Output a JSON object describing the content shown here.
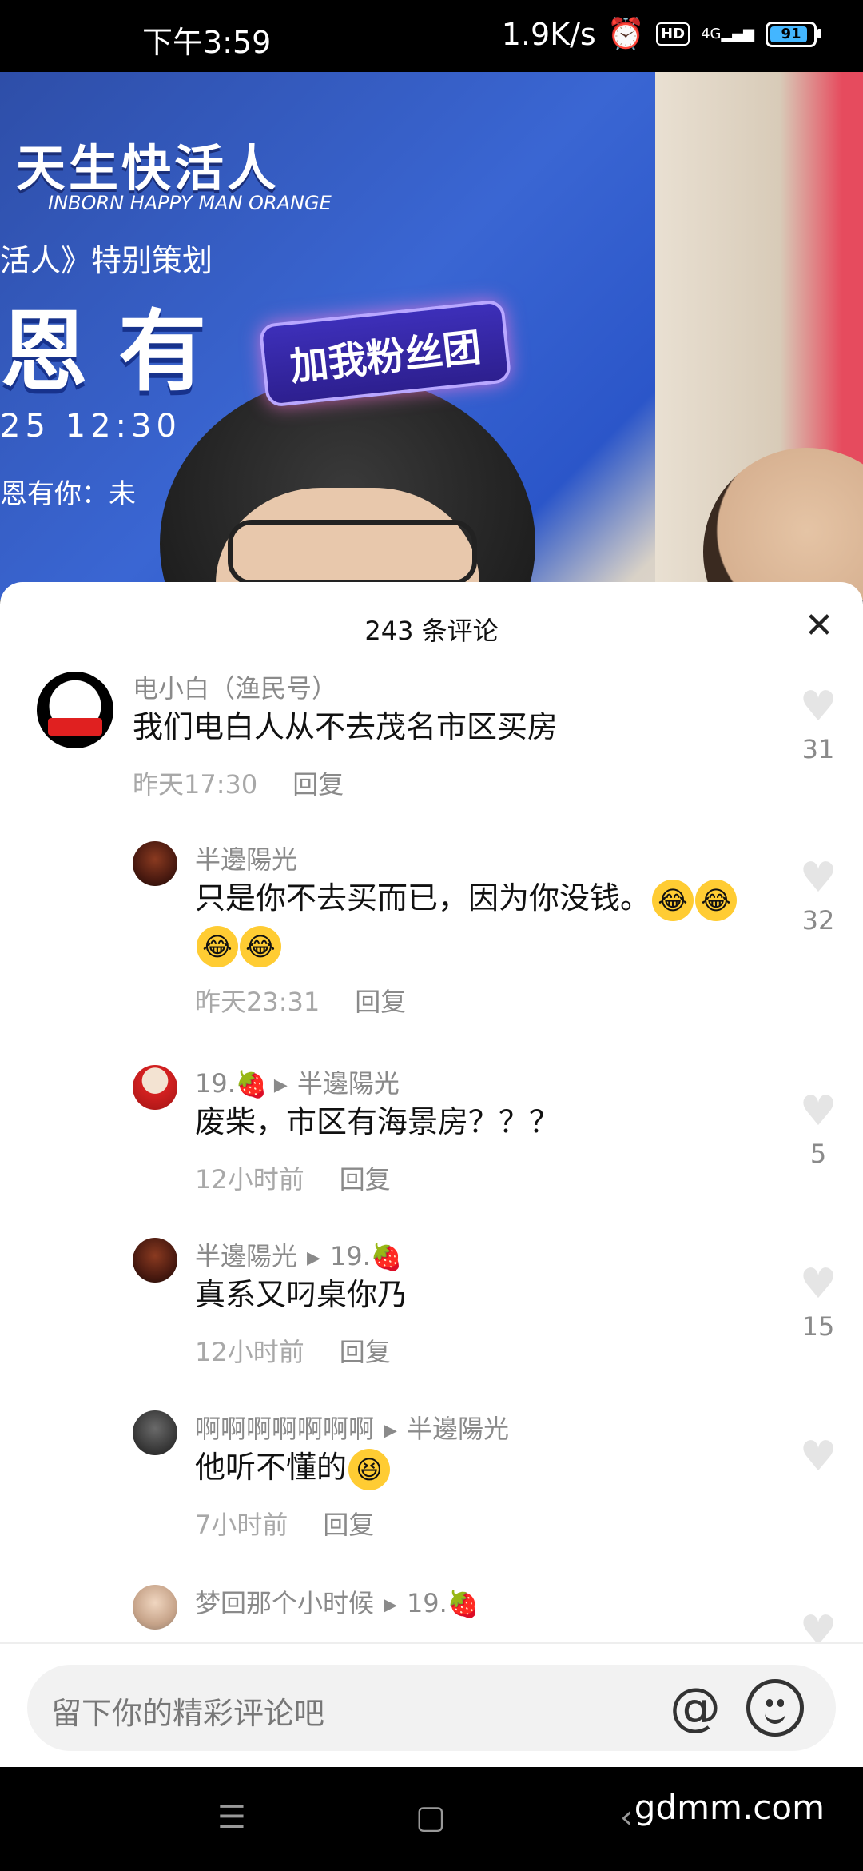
{
  "status_bar": {
    "time": "下午3:59",
    "speed": "1.9K/s",
    "hd": "HD",
    "network": "4G",
    "battery": "91"
  },
  "video": {
    "brand_title": "天生快活人",
    "brand_sub": "INBORN HAPPY MAN ORANGE",
    "line2": "活人》特别策划",
    "big_text": "恩 有",
    "date_text": "25 12:30",
    "line5": "恩有你：未",
    "fan_badge": "加我粉丝团"
  },
  "comments_header": {
    "title": "243 条评论"
  },
  "comments": [
    {
      "name": "电小白（渔民号）",
      "text": "我们电白人从不去茂名市区买房",
      "time": "昨天17:30",
      "reply": "回复",
      "likes": "31"
    },
    {
      "name": "半邊陽光",
      "text": "只是你不去买而已，因为你没钱。",
      "time": "昨天23:31",
      "reply": "回复",
      "likes": "32"
    },
    {
      "name": "19.",
      "reply_to": "半邊陽光",
      "text": "废柴，市区有海景房？？？",
      "time": "12小时前",
      "reply": "回复",
      "likes": "5"
    },
    {
      "name": "半邊陽光",
      "reply_to": "19.",
      "text": "真系又叼桌你乃",
      "time": "12小时前",
      "reply": "回复",
      "likes": "15"
    },
    {
      "name": "啊啊啊啊啊啊啊",
      "reply_to": "半邊陽光",
      "text": "他听不懂的",
      "time": "7小时前",
      "reply": "回复",
      "likes": ""
    },
    {
      "name": "梦回那个小时候",
      "reply_to": "19.",
      "text": "",
      "time": "",
      "reply": "",
      "likes": ""
    }
  ],
  "input": {
    "placeholder": "留下你的精彩评论吧"
  },
  "watermark": "gdmm.com",
  "icons": {
    "close": "close-icon",
    "heart": "heart-icon",
    "at": "at-icon",
    "emoji": "emoji-icon"
  }
}
